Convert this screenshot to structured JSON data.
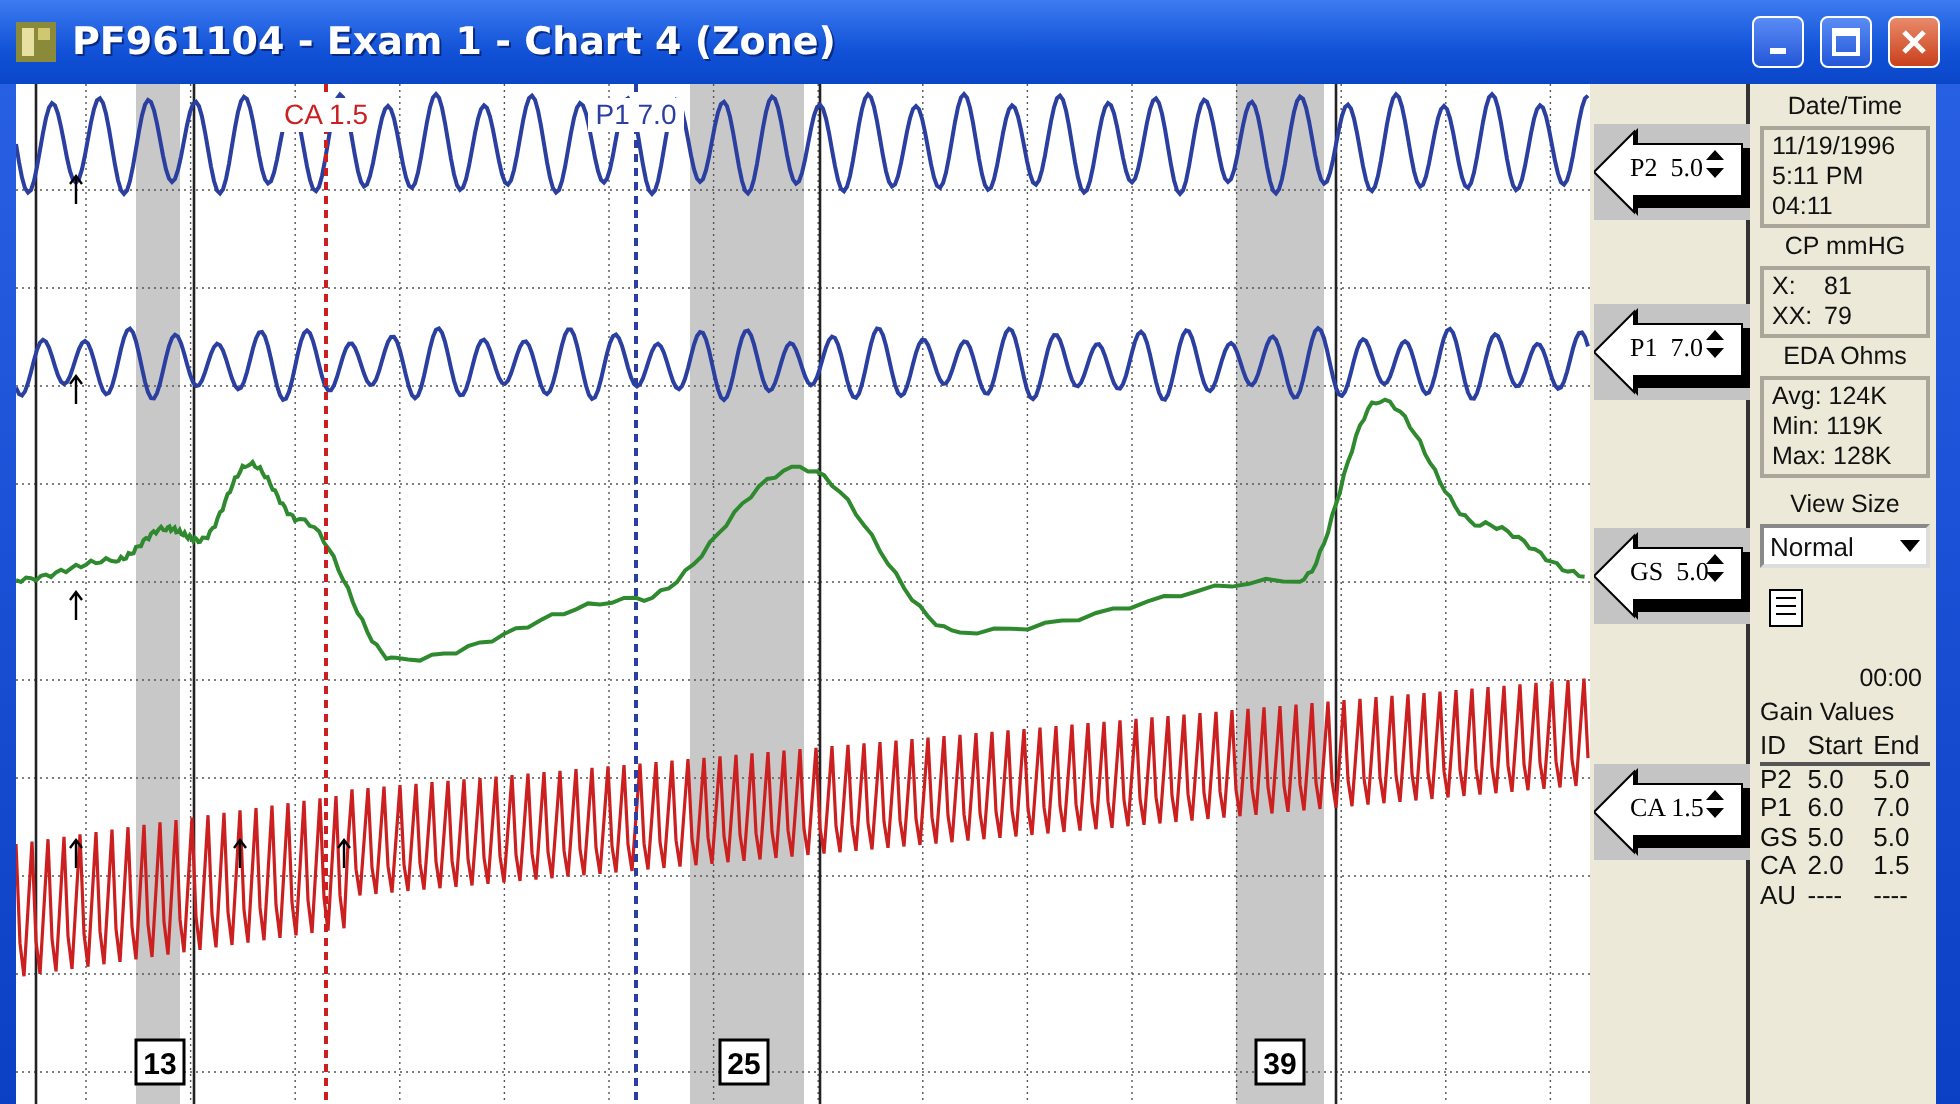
{
  "window": {
    "title": "PF961104 - Exam 1 - Chart 4 (Zone)"
  },
  "chart": {
    "event_markers": [
      {
        "label": "CA 1.5",
        "color": "#cc2020"
      },
      {
        "label": "P1 7.0",
        "color": "#2a3fa0"
      }
    ],
    "question_numbers": [
      "13",
      "25",
      "39"
    ]
  },
  "gain_arrows": [
    {
      "label": "P2  5.0"
    },
    {
      "label": "P1  7.0"
    },
    {
      "label": "GS  5.0"
    },
    {
      "label": "CA 1.5"
    }
  ],
  "side_panel": {
    "date_time": {
      "label": "Date/Time",
      "lines": [
        "11/19/1996",
        "5:11 PM",
        "04:11"
      ]
    },
    "cp": {
      "label": "CP mmHG",
      "rows": [
        {
          "name": "X:",
          "value": "81"
        },
        {
          "name": "XX:",
          "value": "79"
        }
      ]
    },
    "eda": {
      "label": "EDA Ohms",
      "lines": [
        "Avg: 124K",
        "Min: 119K",
        "Max: 128K"
      ]
    },
    "view_size": {
      "label": "View Size",
      "value": "Normal"
    },
    "timer": "00:00",
    "gain_values": {
      "title": "Gain Values",
      "columns": [
        "ID",
        "Start",
        "End"
      ],
      "rows": [
        [
          "P2",
          "5.0",
          "5.0"
        ],
        [
          "P1",
          "6.0",
          "7.0"
        ],
        [
          "GS",
          "5.0",
          "5.0"
        ],
        [
          "CA",
          "2.0",
          "1.5"
        ],
        [
          "AU",
          "----",
          "----"
        ]
      ]
    }
  }
}
